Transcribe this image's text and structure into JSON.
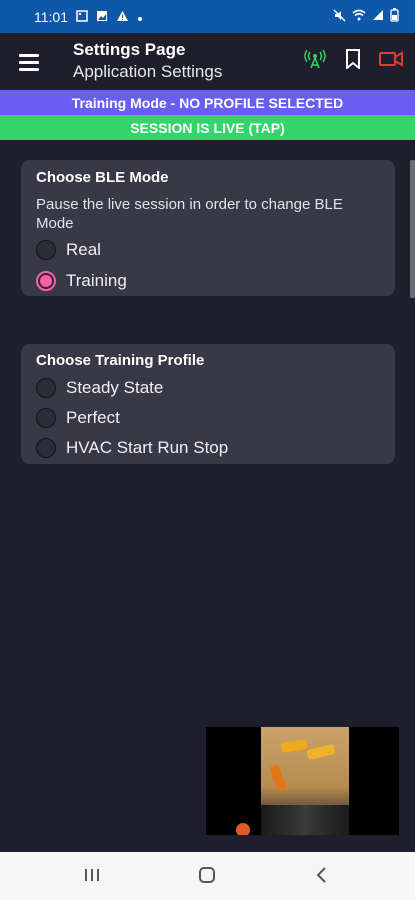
{
  "status_bar": {
    "time": "11:01",
    "left_icons": [
      "image-icon",
      "photo-icon",
      "warning-icon",
      "dot-icon"
    ],
    "right_icons": [
      "mute-icon",
      "wifi-icon",
      "signal-icon",
      "battery-icon"
    ]
  },
  "app_bar": {
    "title": "Settings Page",
    "subtitle": "Application Settings",
    "actions": [
      "antenna-icon",
      "bookmark-icon",
      "video-camera-icon"
    ],
    "colors": {
      "antenna": "#33d56a",
      "bookmark": "#ffffff",
      "camera": "#e53935"
    }
  },
  "banners": {
    "mode": "Training Mode - NO PROFILE SELECTED",
    "live": "SESSION IS LIVE (TAP)",
    "mode_color": "#6a5ef0",
    "live_color": "#33d56a"
  },
  "ble_mode": {
    "title": "Choose BLE Mode",
    "description": "Pause the live session in order to change BLE Mode",
    "options": [
      {
        "label": "Real",
        "selected": false
      },
      {
        "label": "Training",
        "selected": true
      }
    ]
  },
  "training_profile": {
    "title": "Choose Training Profile",
    "options": [
      {
        "label": "Steady State",
        "selected": false
      },
      {
        "label": "Perfect",
        "selected": false
      },
      {
        "label": "HVAC Start Run Stop",
        "selected": false
      }
    ]
  },
  "accent_color": "#ff5fa8",
  "nav_bar": [
    "recent-apps-icon",
    "home-icon",
    "back-icon"
  ]
}
